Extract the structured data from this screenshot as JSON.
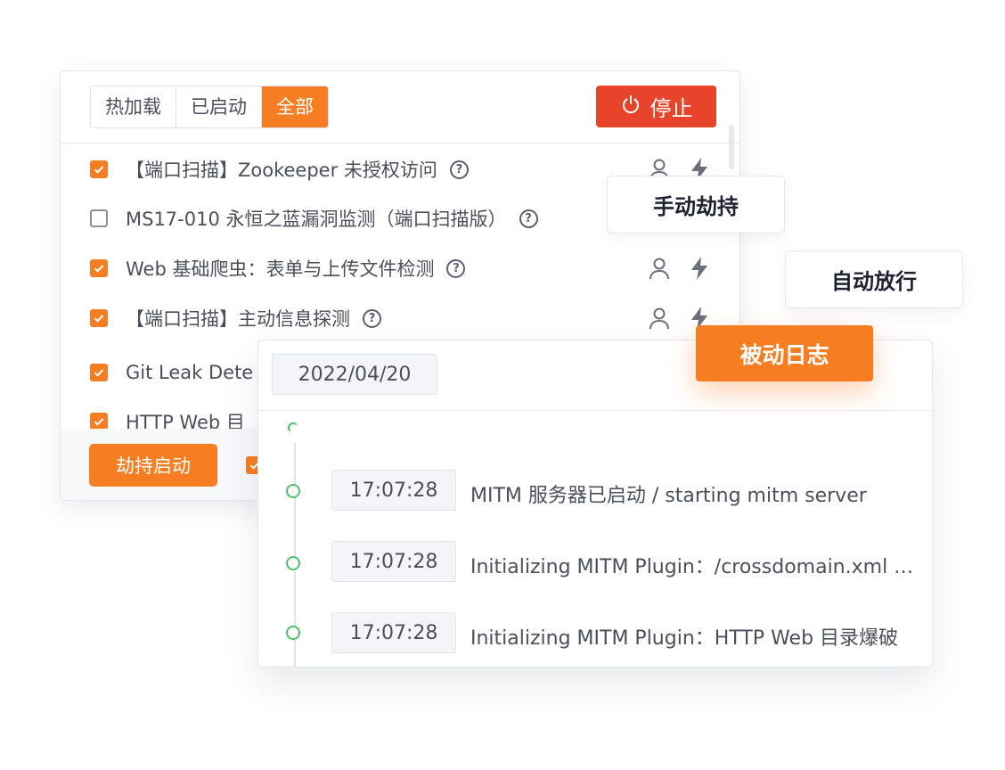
{
  "filters": {
    "hot_load": "热加载",
    "started": "已启动",
    "all": "全部",
    "active": "all"
  },
  "stop_button": {
    "label": "停止"
  },
  "plugins": [
    {
      "name": "【端口扫描】Zookeeper 未授权访问",
      "checked": true,
      "icons": true
    },
    {
      "name": "MS17-010 永恒之蓝漏洞监测（端口扫描版）",
      "checked": false,
      "icons": false
    },
    {
      "name": "Web 基础爬虫：表单与上传文件检测",
      "checked": true,
      "icons": true
    },
    {
      "name": "【端口扫描】主动信息探测",
      "checked": true,
      "icons": true
    },
    {
      "name": "Git Leak Dete",
      "checked": true,
      "icons": false
    },
    {
      "name": "HTTP Web 目",
      "checked": true,
      "icons": false
    }
  ],
  "hijack_start_button": {
    "label": "劫持启动"
  },
  "tags": {
    "manual_hijack": "手动劫持",
    "auto_release": "自动放行",
    "passive_log": "被动日志"
  },
  "log": {
    "date": "2022/04/20",
    "entries": [
      {
        "time": "17:07:28",
        "message": "MITM 服务器已启动 / starting mitm server"
      },
      {
        "time": "17:07:28",
        "message": "Initializing MITM Plugin：/crossdomain.xml 文件检测"
      },
      {
        "time": "17:07:28",
        "message": "Initializing MITM Plugin：HTTP Web 目录爆破"
      }
    ]
  },
  "colors": {
    "accent": "#f67d22",
    "stop": "#e8432b",
    "timeline_dot": "#4cc36e"
  }
}
